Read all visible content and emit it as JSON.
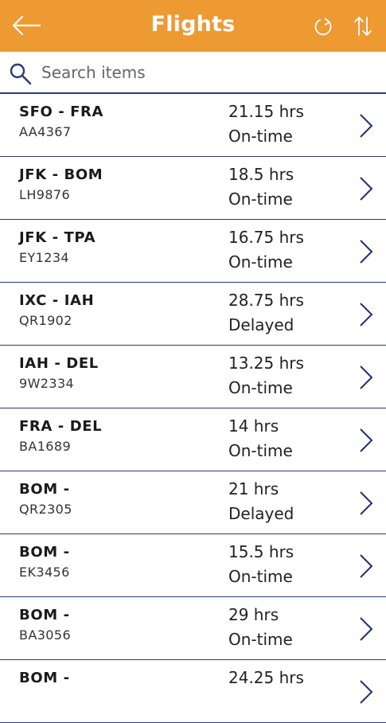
{
  "header": {
    "title": "Flights",
    "color": "#ED9A33",
    "back_icon": "arrow-left-icon",
    "refresh_icon": "refresh-icon",
    "sort_icon": "sort-icon"
  },
  "search": {
    "placeholder": "Search items",
    "value": ""
  },
  "flights": [
    {
      "route": "SFO - FRA",
      "code": "AA4367",
      "duration": "21.15 hrs",
      "status": "On-time"
    },
    {
      "route": "JFK - BOM",
      "code": "LH9876",
      "duration": "18.5 hrs",
      "status": "On-time"
    },
    {
      "route": "JFK - TPA",
      "code": "EY1234",
      "duration": "16.75 hrs",
      "status": "On-time"
    },
    {
      "route": "IXC - IAH",
      "code": "QR1902",
      "duration": "28.75 hrs",
      "status": "Delayed"
    },
    {
      "route": "IAH - DEL",
      "code": "9W2334",
      "duration": "13.25 hrs",
      "status": "On-time"
    },
    {
      "route": "FRA - DEL",
      "code": "BA1689",
      "duration": "14 hrs",
      "status": "On-time"
    },
    {
      "route": "BOM -",
      "code": "QR2305",
      "duration": "21 hrs",
      "status": "Delayed"
    },
    {
      "route": "BOM -",
      "code": "EK3456",
      "duration": "15.5 hrs",
      "status": "On-time"
    },
    {
      "route": "BOM -",
      "code": "BA3056",
      "duration": "29 hrs",
      "status": "On-time"
    },
    {
      "route": "BOM -",
      "code": "",
      "duration": "24.25 hrs",
      "status": ""
    }
  ]
}
